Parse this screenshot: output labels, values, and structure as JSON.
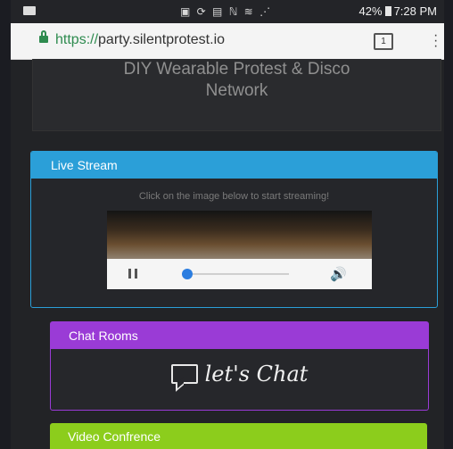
{
  "status_bar": {
    "icons": "▣ ⟳ ▤ ℕ ≋ ⋰",
    "battery": "42%",
    "time": "7:28 PM"
  },
  "browser": {
    "url_scheme": "https://",
    "url_host": "party.silentprotest.io",
    "tab_count": "1"
  },
  "header": {
    "title_line1": "DIY Wearable Protest & Disco",
    "title_line2": "Network"
  },
  "live_stream": {
    "title": "Live Stream",
    "hint": "Click on the image below to start streaming!",
    "progress": 0.0
  },
  "chat_rooms": {
    "title": "Chat Rooms",
    "logo_text": "let's Chat"
  },
  "video_conference": {
    "title": "Video Confrence"
  },
  "colors": {
    "live_stream_accent": "#2b9fd8",
    "chat_accent": "#9a3bd6",
    "video_accent": "#8ccd1c"
  }
}
